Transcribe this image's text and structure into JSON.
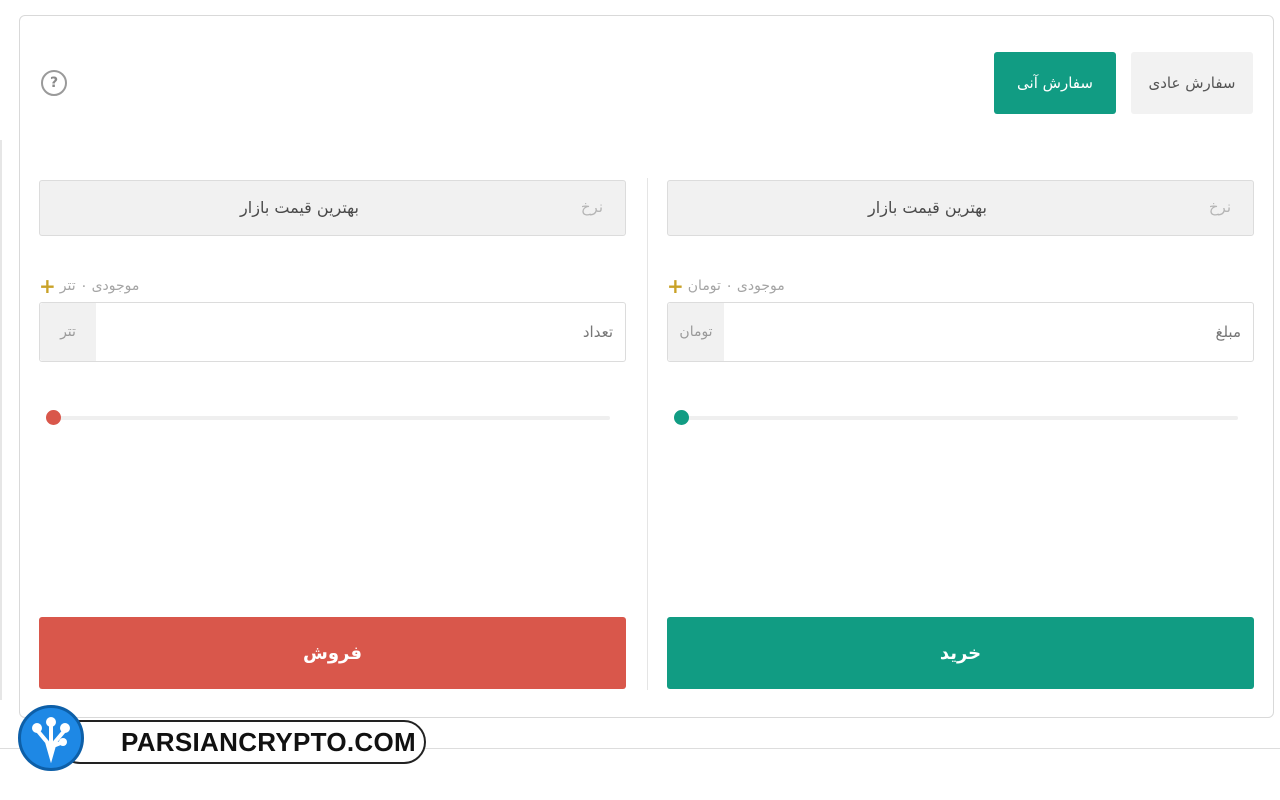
{
  "tabs": {
    "normal_order": "سفارش عادی",
    "instant_order": "سفارش آنی"
  },
  "help_icon": "?",
  "buy": {
    "rate_label": "نرخ",
    "rate_value": "بهترین قیمت بازار",
    "balance_label": "موجودی",
    "balance_value": "۰ تومان",
    "amount_placeholder": "مبلغ",
    "amount_unit": "تومان",
    "slider_value_percent": 0,
    "button_label": "خرید",
    "color": "#119c83"
  },
  "sell": {
    "rate_label": "نرخ",
    "rate_value": "بهترین قیمت بازار",
    "balance_label": "موجودی",
    "balance_value": "۰ تتر",
    "amount_placeholder": "تعداد",
    "amount_unit": "تتر",
    "slider_value_percent": 0,
    "button_label": "فروش",
    "color": "#d9574b"
  },
  "watermark": {
    "text": "PARSIANCRYPTO.COM"
  }
}
